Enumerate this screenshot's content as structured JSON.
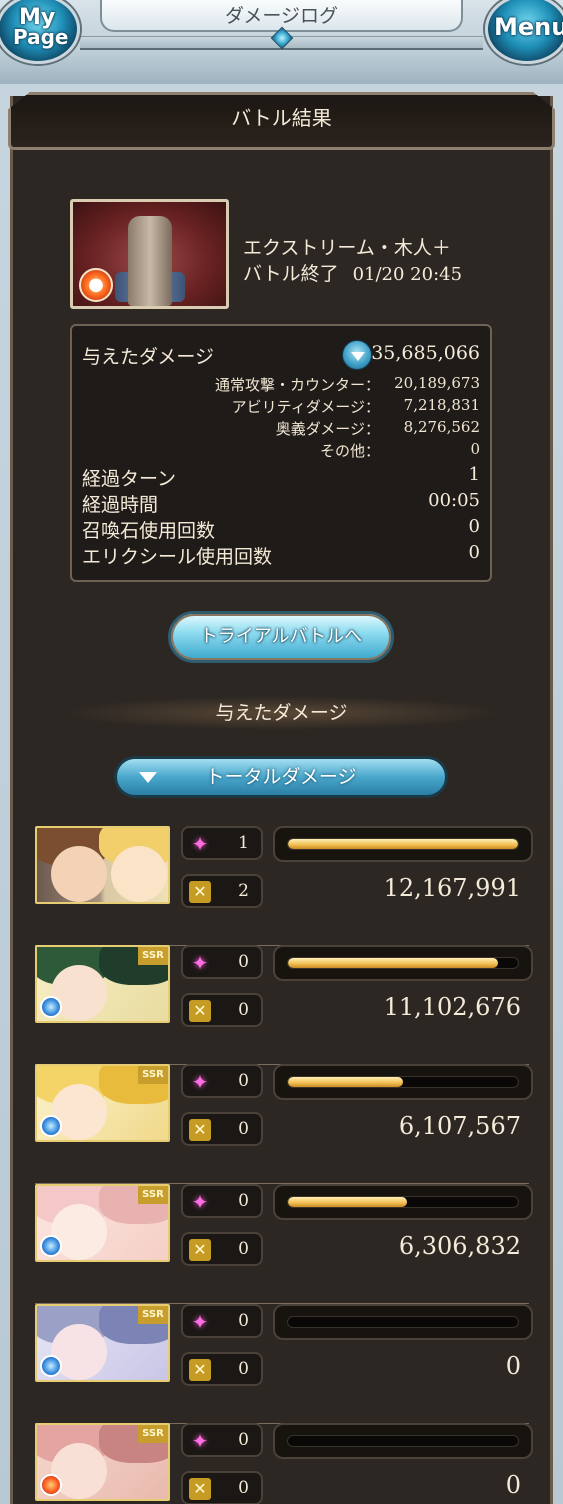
{
  "header": {
    "title": "ダメージログ",
    "mypage_line1": "My",
    "mypage_line2": "Page",
    "menu_label": "Menu"
  },
  "panel": {
    "title": "バトル結果"
  },
  "battle": {
    "boss_name": "エクストリーム・木人＋",
    "status_label": "バトル終了",
    "datetime": "01/20 20:45"
  },
  "stats": {
    "damage_label": "与えたダメージ",
    "damage_total": "35,685,066",
    "breakdown": [
      {
        "label": "通常攻撃・カウンター：",
        "value": "20,189,673"
      },
      {
        "label": "アビリティダメージ：",
        "value": "7,218,831"
      },
      {
        "label": "奥義ダメージ：",
        "value": "8,276,562"
      },
      {
        "label": "その他：",
        "value": "0"
      }
    ],
    "turns_label": "経過ターン",
    "turns": "1",
    "time_label": "経過時間",
    "time": "00:05",
    "summon_label": "召喚石使用回数",
    "summon": "0",
    "elixir_label": "エリクシール使用回数",
    "elixir": "0"
  },
  "trial_button": "トライアルバトルへ",
  "section_label": "与えたダメージ",
  "total_select": "トータルダメージ",
  "icons": {
    "charge_attack": "✦",
    "chain": "✕"
  },
  "colors": {
    "bar_fill": "#f0bd4e",
    "panel_bg": "#2c2723",
    "accent_blue": "#3aa6cc"
  },
  "characters": [
    {
      "ca": "1",
      "chain": "2",
      "damage": "12,167,991",
      "ratio": 1.0,
      "element": "fire",
      "ssr": false
    },
    {
      "ca": "0",
      "chain": "0",
      "damage": "11,102,676",
      "ratio": 0.912,
      "element": "water",
      "ssr": true
    },
    {
      "ca": "0",
      "chain": "0",
      "damage": "6,107,567",
      "ratio": 0.502,
      "element": "water",
      "ssr": true
    },
    {
      "ca": "0",
      "chain": "0",
      "damage": "6,306,832",
      "ratio": 0.518,
      "element": "water",
      "ssr": true
    },
    {
      "ca": "0",
      "chain": "0",
      "damage": "0",
      "ratio": 0,
      "element": "water",
      "ssr": true
    },
    {
      "ca": "0",
      "chain": "0",
      "damage": "0",
      "ratio": 0,
      "element": "fire",
      "ssr": true
    }
  ],
  "ssr_badge": "SSR"
}
